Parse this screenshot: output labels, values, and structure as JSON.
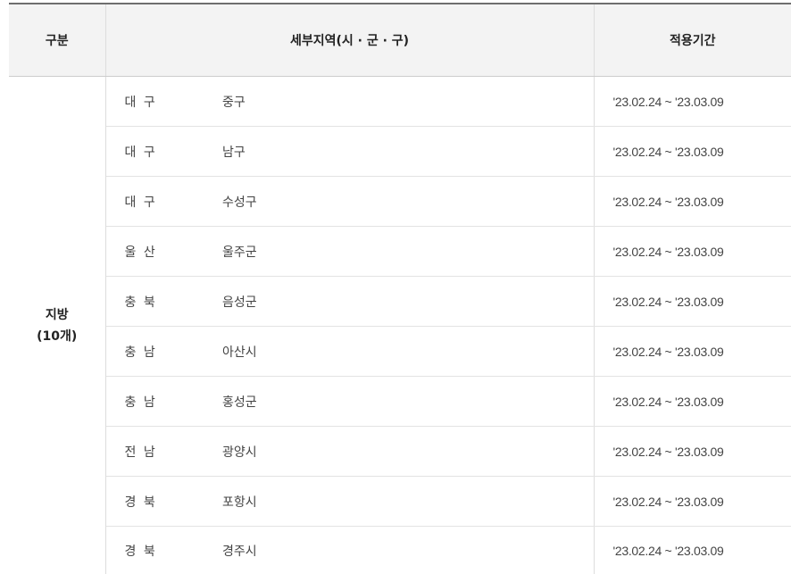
{
  "table": {
    "headers": {
      "category": "구분",
      "sub_region": "세부지역(시 · 군 · 구)",
      "period": "적용기간"
    },
    "group": {
      "label": "지방",
      "count": "(10개)"
    },
    "rows": [
      {
        "province": "대 구",
        "district": "중구",
        "period": "'23.02.24 ~ '23.03.09"
      },
      {
        "province": "대 구",
        "district": "남구",
        "period": "'23.02.24 ~ '23.03.09"
      },
      {
        "province": "대 구",
        "district": "수성구",
        "period": "'23.02.24 ~ '23.03.09"
      },
      {
        "province": "울 산",
        "district": "울주군",
        "period": "'23.02.24 ~ '23.03.09"
      },
      {
        "province": "충 북",
        "district": "음성군",
        "period": "'23.02.24 ~ '23.03.09"
      },
      {
        "province": "충 남",
        "district": "아산시",
        "period": "'23.02.24 ~ '23.03.09"
      },
      {
        "province": "충 남",
        "district": "홍성군",
        "period": "'23.02.24 ~ '23.03.09"
      },
      {
        "province": "전 남",
        "district": "광양시",
        "period": "'23.02.24 ~ '23.03.09"
      },
      {
        "province": "경 북",
        "district": "포항시",
        "period": "'23.02.24 ~ '23.03.09"
      },
      {
        "province": "경 북",
        "district": "경주시",
        "period": "'23.02.24 ~ '23.03.09"
      }
    ]
  }
}
